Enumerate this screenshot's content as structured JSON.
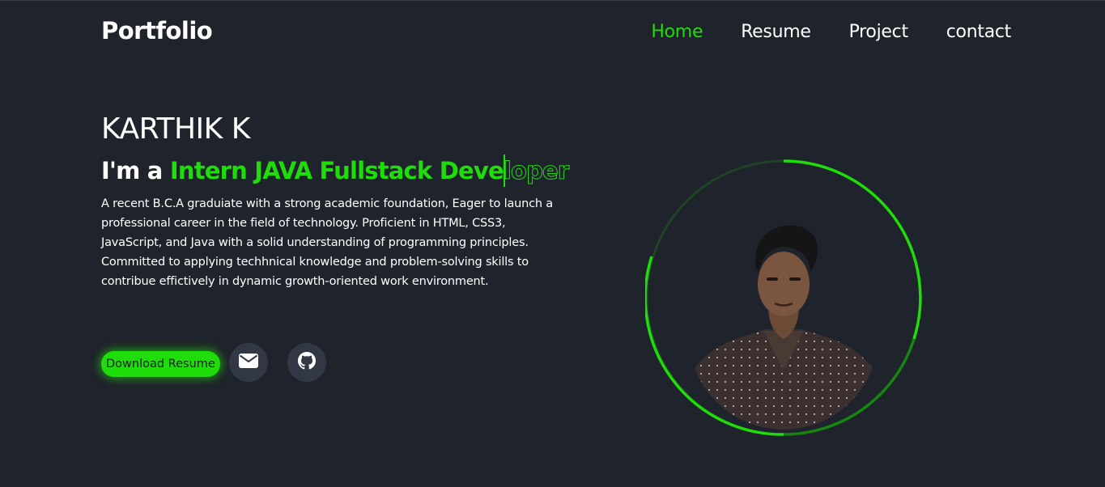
{
  "header": {
    "logo": "Portfolio",
    "nav": [
      {
        "label": "Home",
        "active": true
      },
      {
        "label": "Resume",
        "active": false
      },
      {
        "label": "Project",
        "active": false
      },
      {
        "label": "contact",
        "active": false
      }
    ]
  },
  "hero": {
    "name": "KARTHIK K",
    "role_prefix": "I'm a",
    "role_typed": "Intern JAVA Fullstack Deve",
    "role_rest": "loper",
    "bio": "A recent B.C.A graduiate with a strong academic foundation, Eager to launch a professional career in the field of technology. Proficient in HTML, CSS3, JavaScript, and Java with a solid understanding of programming principles. Committed to applying techhnical knowledge and problem-solving skills to contribue effictively in dynamic growth-oriented work environment."
  },
  "actions": {
    "download_label": "Download Resume",
    "email_icon": "envelope-icon",
    "github_icon": "github-icon"
  },
  "colors": {
    "background": "#1f232b",
    "accent": "#1fdd0a",
    "icon_bg": "#323845"
  }
}
